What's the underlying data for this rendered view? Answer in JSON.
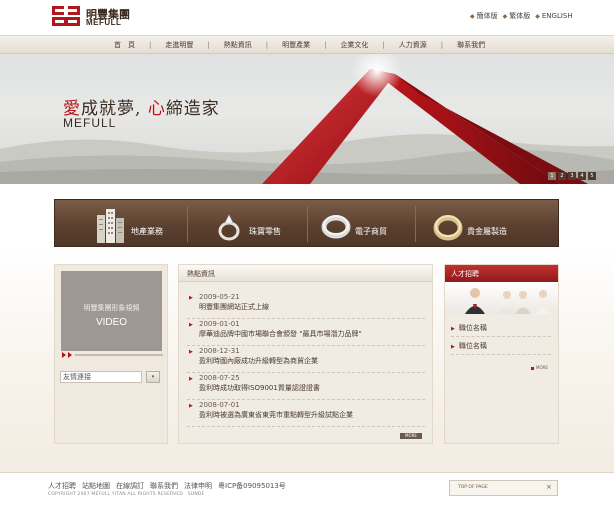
{
  "header": {
    "logo_cn": "明豐集團",
    "logo_en": "MEFULL",
    "lang": [
      "簡体版",
      "繁体版",
      "ENGLISH"
    ]
  },
  "nav": [
    "首　頁",
    "走進明豐",
    "熱點資訊",
    "明豐產業",
    "企業文化",
    "人力資源",
    "聯系我們"
  ],
  "banner": {
    "slogan_a": "愛",
    "slogan_b": "成就夢, ",
    "slogan_c": "心",
    "slogan_d": "締造家",
    "slogan_en": "MEFULL",
    "pager": [
      "1",
      "2",
      "3",
      "4",
      "5"
    ]
  },
  "business": [
    "地產業務",
    "珠寶零售",
    "電子商貿",
    "貴金屬製造"
  ],
  "left": {
    "video_cn": "明豐集團形象視頻",
    "video_en": "VIDEO",
    "link_value": "友情連接",
    "link_btn": "▾"
  },
  "news": {
    "title": "熱點資訊",
    "items": [
      {
        "date": "2009-05-21",
        "text": "明豐集團網站正式上線"
      },
      {
        "date": "2009-01-01",
        "text": "摩華迪品牌中國市場聯合會頒發 \"最具市場潛力品牌\""
      },
      {
        "date": "2008-12-31",
        "text": "盈利時國內廠成功升級轉型為商貿企業"
      },
      {
        "date": "2008-07-25",
        "text": "盈利時成功取得ISO9001質量認證證書"
      },
      {
        "date": "2008-07-01",
        "text": "盈利時被選為廣東省東莞市重點轉型升級試點企業"
      }
    ],
    "more": "MORE"
  },
  "jobs": {
    "title": "人才招聘",
    "items": [
      "職位名稱",
      "職位名稱"
    ],
    "more": "MORE"
  },
  "footer": {
    "links": [
      "人才招聘",
      "站點地圖",
      "在線調訂",
      "聯系我們",
      "法律申明",
      "粵ICP备09095013号"
    ],
    "copyright": "COPYRIGHT 2007 MEFULL YITAN ALL RIGHTS RESERVED",
    "credit": "SUNDE",
    "top": "TOP OF PAGE",
    "top_close": "×"
  },
  "colors": {
    "brand_red": "#b8121a",
    "brown": "#5a3f2e"
  }
}
